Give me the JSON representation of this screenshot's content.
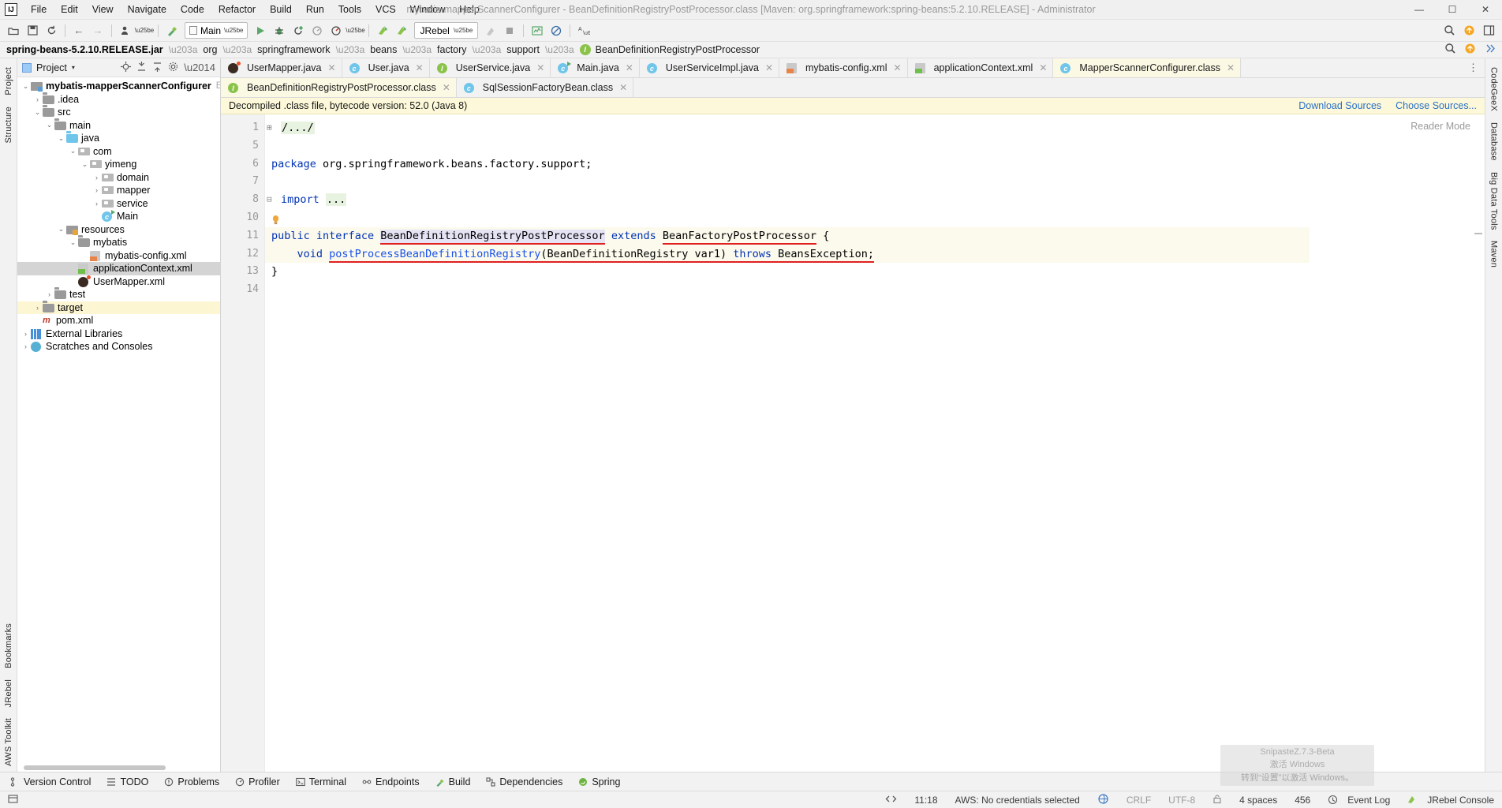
{
  "window": {
    "title": "mybatis-mapperScannerConfigurer - BeanDefinitionRegistryPostProcessor.class [Maven: org.springframework:spring-beans:5.2.10.RELEASE] - Administrator",
    "logo": "IJ",
    "minimize": "—",
    "maximize": "☐",
    "close": "✕"
  },
  "menu": [
    "File",
    "Edit",
    "View",
    "Navigate",
    "Code",
    "Refactor",
    "Build",
    "Run",
    "Tools",
    "VCS",
    "Window",
    "Help"
  ],
  "toolbar": {
    "open_icon": "open-folder-icon",
    "save_icon": "save-icon",
    "sync_icon": "sync-icon",
    "back_icon": "←",
    "forward_icon": "→",
    "profile_icon": "user-profile-icon",
    "build_icon": "hammer-icon",
    "run_config": "Main",
    "run_icon": "run-icon",
    "debug_icon": "debug-icon",
    "coverage_icon": "coverage-icon",
    "profiler_icon": "profiler-icon",
    "attach_icon": "attach-icon",
    "jrebel_run_icon": "jrebel-run-icon",
    "jrebel_debug_icon": "jrebel-debug-icon",
    "jrebel_config": "JRebel",
    "stop_icon": "stop-icon",
    "stop_square_icon": "stop-square-icon",
    "chart_icon": "chart-icon",
    "disabled_icon": "no-entry-icon",
    "translate_icon": "translate-icon",
    "search_icon": "search-icon",
    "update_icon": "update-icon",
    "layout_icon": "layout-icon"
  },
  "breadcrumb": {
    "root": "spring-beans-5.2.10.RELEASE.jar",
    "items": [
      "org",
      "springframework",
      "beans",
      "factory",
      "support"
    ],
    "leaf": "BeanDefinitionRegistryPostProcessor",
    "leaf_icon_letter": "I"
  },
  "left_rail": [
    "Project",
    "Structure"
  ],
  "left_rail_bottom": [
    "Bookmarks",
    "JRebel",
    "AWS Toolkit"
  ],
  "right_rail": [
    "CodeGeeX",
    "Database",
    "Big Data Tools",
    "Maven"
  ],
  "project_panel": {
    "title": "Project",
    "title_caret": "▾",
    "actions": [
      "locate-icon",
      "expand-all-icon",
      "collapse-all-icon",
      "settings-icon",
      "hide-icon"
    ],
    "tree": [
      {
        "depth": 0,
        "arrow": "⌄",
        "icon": "folder-module",
        "label": "mybatis-mapperScannerConfigurer",
        "bold": true,
        "path": "E:\\mybati",
        "selected": false
      },
      {
        "depth": 1,
        "arrow": "›",
        "icon": "folder",
        "label": ".idea",
        "bold": false,
        "selected": false
      },
      {
        "depth": 1,
        "arrow": "⌄",
        "icon": "folder",
        "label": "src",
        "bold": false,
        "selected": false
      },
      {
        "depth": 2,
        "arrow": "⌄",
        "icon": "folder",
        "label": "main",
        "bold": false,
        "selected": false
      },
      {
        "depth": 3,
        "arrow": "⌄",
        "icon": "folder-blue",
        "label": "java",
        "bold": false,
        "selected": false
      },
      {
        "depth": 4,
        "arrow": "⌄",
        "icon": "package",
        "label": "com",
        "bold": false,
        "selected": false
      },
      {
        "depth": 5,
        "arrow": "⌄",
        "icon": "package",
        "label": "yimeng",
        "bold": false,
        "selected": false
      },
      {
        "depth": 6,
        "arrow": "›",
        "icon": "package",
        "label": "domain",
        "bold": false,
        "selected": false
      },
      {
        "depth": 6,
        "arrow": "›",
        "icon": "package",
        "label": "mapper",
        "bold": false,
        "selected": false
      },
      {
        "depth": 6,
        "arrow": "›",
        "icon": "package",
        "label": "service",
        "bold": false,
        "selected": false
      },
      {
        "depth": 6,
        "arrow": "",
        "icon": "class-runnable",
        "label": "Main",
        "bold": false,
        "selected": false
      },
      {
        "depth": 3,
        "arrow": "⌄",
        "icon": "folder-resources",
        "label": "resources",
        "bold": false,
        "selected": false
      },
      {
        "depth": 4,
        "arrow": "⌄",
        "icon": "folder",
        "label": "mybatis",
        "bold": false,
        "selected": false
      },
      {
        "depth": 5,
        "arrow": "",
        "icon": "xml",
        "label": "mybatis-config.xml",
        "bold": false,
        "selected": false
      },
      {
        "depth": 4,
        "arrow": "",
        "icon": "xml-spring",
        "label": "applicationContext.xml",
        "bold": false,
        "selected": true
      },
      {
        "depth": 4,
        "arrow": "",
        "icon": "mybatis",
        "label": "UserMapper.xml",
        "bold": false,
        "selected": false
      },
      {
        "depth": 2,
        "arrow": "›",
        "icon": "folder",
        "label": "test",
        "bold": false,
        "selected": false
      },
      {
        "depth": 1,
        "arrow": "›",
        "icon": "folder",
        "label": "target",
        "bold": false,
        "selected": false,
        "highlight": true
      },
      {
        "depth": 1,
        "arrow": "",
        "icon": "maven",
        "label": "pom.xml",
        "bold": false,
        "selected": false
      },
      {
        "depth": 0,
        "arrow": "›",
        "icon": "library",
        "label": "External Libraries",
        "bold": false,
        "selected": false
      },
      {
        "depth": 0,
        "arrow": "›",
        "icon": "scratch",
        "label": "Scratches and Consoles",
        "bold": false,
        "selected": false
      }
    ]
  },
  "editor_tabs_row1": [
    {
      "label": "UserMapper.java",
      "icon": "mybatis-icon",
      "active": false
    },
    {
      "label": "User.java",
      "icon": "class-icon",
      "active": false
    },
    {
      "label": "UserService.java",
      "icon": "interface-icon",
      "active": false
    },
    {
      "label": "Main.java",
      "icon": "class-runnable-icon",
      "active": false
    },
    {
      "label": "UserServiceImpl.java",
      "icon": "class-icon",
      "active": false
    },
    {
      "label": "mybatis-config.xml",
      "icon": "xml-icon",
      "active": false
    },
    {
      "label": "applicationContext.xml",
      "icon": "xml-spring-icon",
      "active": false
    },
    {
      "label": "MapperScannerConfigurer.class",
      "icon": "class-decompiled-icon",
      "active": true
    }
  ],
  "editor_tabs_row2": [
    {
      "label": "BeanDefinitionRegistryPostProcessor.class",
      "icon": "interface-decompiled-icon",
      "active": true
    },
    {
      "label": "SqlSessionFactoryBean.class",
      "icon": "class-decompiled-icon",
      "active": false
    }
  ],
  "notice": {
    "text": "Decompiled .class file, bytecode version: 52.0 (Java 8)",
    "links": [
      "Download Sources",
      "Choose Sources..."
    ]
  },
  "editor": {
    "reader_mode": "Reader Mode",
    "line_numbers": [
      "1",
      "5",
      "6",
      "7",
      "8",
      "10",
      "11",
      "12",
      "13",
      "14"
    ],
    "lines": [
      {
        "num": "1",
        "fold": "⊞",
        "segments": [
          {
            "t": "/.../",
            "cls": "folded"
          }
        ]
      },
      {
        "num": "5",
        "segments": []
      },
      {
        "num": "6",
        "segments": [
          {
            "t": "package",
            "cls": "kw"
          },
          {
            "t": " org.springframework.beans.factory.support;",
            "cls": ""
          }
        ]
      },
      {
        "num": "7",
        "segments": []
      },
      {
        "num": "8",
        "fold": "⊟",
        "segments": [
          {
            "t": "import",
            "cls": "kw"
          },
          {
            "t": " ",
            "cls": ""
          },
          {
            "t": "...",
            "cls": "folded"
          }
        ]
      },
      {
        "num": "10",
        "segments": [],
        "bulb": true
      },
      {
        "num": "11",
        "gutter_mark": "implemented",
        "highlight": true,
        "segments": [
          {
            "t": "public",
            "cls": "kw"
          },
          {
            "t": " ",
            "cls": ""
          },
          {
            "t": "interface",
            "cls": "kw"
          },
          {
            "t": " ",
            "cls": ""
          },
          {
            "t": "BeanDefinitionRegistryPostProcessor",
            "cls": "ident-hl red-underline"
          },
          {
            "t": " ",
            "cls": ""
          },
          {
            "t": "extends",
            "cls": "kw"
          },
          {
            "t": " ",
            "cls": ""
          },
          {
            "t": "BeanFactoryPostProcessor",
            "cls": "red-underline"
          },
          {
            "t": " {",
            "cls": ""
          }
        ]
      },
      {
        "num": "12",
        "gutter_mark": "implemented",
        "highlight": true,
        "segments": [
          {
            "t": "    ",
            "cls": ""
          },
          {
            "t": "void",
            "cls": "kw"
          },
          {
            "t": " ",
            "cls": ""
          },
          {
            "t": "postProcessBeanDefinitionRegistry",
            "cls": "method-name red-underline"
          },
          {
            "t": "(BeanDefinitionRegistry var1) ",
            "cls": "red-underline"
          },
          {
            "t": "throws",
            "cls": "kw red-underline"
          },
          {
            "t": " BeansException;",
            "cls": "red-underline"
          }
        ]
      },
      {
        "num": "13",
        "segments": [
          {
            "t": "}",
            "cls": ""
          }
        ]
      },
      {
        "num": "14",
        "segments": []
      }
    ]
  },
  "bottom_windows": [
    {
      "label": "Version Control",
      "icon": "branch-icon"
    },
    {
      "label": "TODO",
      "icon": "todo-icon"
    },
    {
      "label": "Problems",
      "icon": "problems-icon"
    },
    {
      "label": "Profiler",
      "icon": "profiler-icon"
    },
    {
      "label": "Terminal",
      "icon": "terminal-icon"
    },
    {
      "label": "Endpoints",
      "icon": "endpoints-icon"
    },
    {
      "label": "Build",
      "icon": "hammer-icon"
    },
    {
      "label": "Dependencies",
      "icon": "dependencies-icon"
    },
    {
      "label": "Spring",
      "icon": "spring-icon"
    }
  ],
  "status_bar": {
    "left_icon": "event-log-toggle-icon",
    "code_icon": "code-with-me-icon",
    "time": "11:18",
    "aws": "AWS: No credentials selected",
    "aws_icon": "aws-icon",
    "line_sep": "CRLF",
    "encoding": "UTF-8",
    "lock_icon": "unlock-icon",
    "indent": "4 spaces",
    "memory": "456 ",
    "event_log": "Event Log",
    "event_log_icon": "event-log-icon",
    "jrebel_console": "JRebel Console",
    "jrebel_icon": "jrebel-icon"
  },
  "watermark": {
    "line1": "SnipasteZ.7.3-Beta",
    "line2": "激活 Windows",
    "line3": "转到“设置”以激活 Windows。"
  }
}
